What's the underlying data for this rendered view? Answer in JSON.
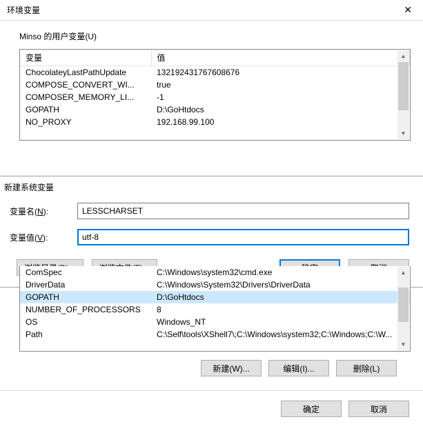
{
  "window": {
    "title": "环境变量",
    "close_icon": "✕"
  },
  "user_section": {
    "label": "Minso 的用户变量(U)",
    "headers": {
      "var": "变量",
      "val": "值"
    },
    "rows": [
      {
        "var": "ChocolateyLastPathUpdate",
        "val": "132192431767608676"
      },
      {
        "var": "COMPOSE_CONVERT_WI...",
        "val": "true"
      },
      {
        "var": "COMPOSER_MEMORY_LI...",
        "val": "-1"
      },
      {
        "var": "GOPATH",
        "val": "D:\\GoHtdocs"
      },
      {
        "var": "NO_PROXY",
        "val": "192.168.99.100"
      }
    ]
  },
  "new_var_dialog": {
    "title": "新建系统变量",
    "name_label_pre": "变量名(",
    "name_label_u": "N",
    "name_label_post": "):",
    "value_label_pre": "变量值(",
    "value_label_u": "V",
    "value_label_post": "):",
    "name_value": "LESSCHARSET",
    "value_value": "utf-8",
    "browse_dir": "浏览目录(D)...",
    "browse_file": "浏览文件(F)...",
    "ok": "确定",
    "cancel": "取消"
  },
  "sys_section": {
    "rows": [
      {
        "var": "ComSpec",
        "val": "C:\\Windows\\system32\\cmd.exe"
      },
      {
        "var": "DriverData",
        "val": "C:\\Windows\\System32\\Drivers\\DriverData"
      },
      {
        "var": "GOPATH",
        "val": "D:\\GoHtdocs"
      },
      {
        "var": "NUMBER_OF_PROCESSORS",
        "val": "8"
      },
      {
        "var": "OS",
        "val": "Windows_NT"
      },
      {
        "var": "Path",
        "val": "C:\\Self\\tools\\XShell7\\;C:\\Windows\\system32;C:\\Windows;C:\\W..."
      }
    ],
    "new_btn": "新建(W)...",
    "edit_btn": "编辑(I)...",
    "del_btn": "删除(L)"
  },
  "footer": {
    "ok": "确定",
    "cancel": "取消"
  }
}
